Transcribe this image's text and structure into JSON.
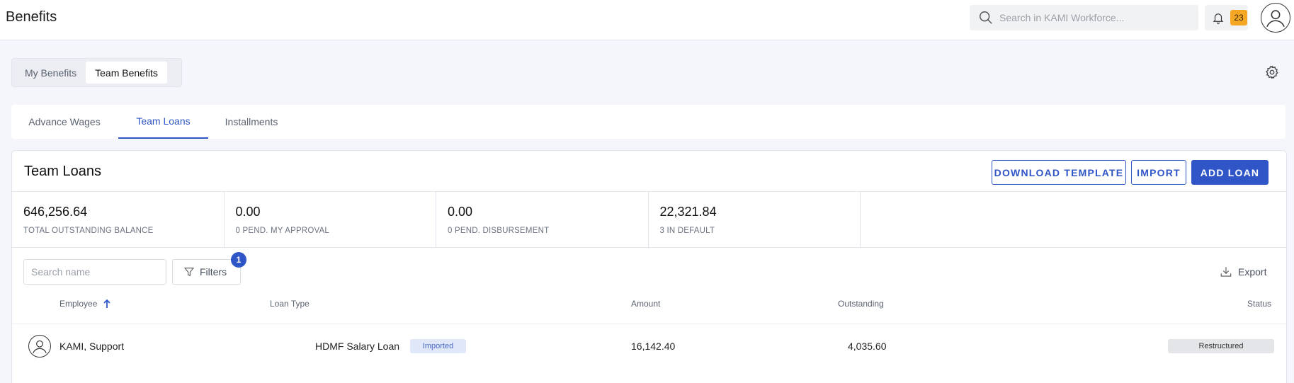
{
  "header": {
    "title": "Benefits",
    "search_placeholder": "Search in KAMI Workforce...",
    "notification_count": "23"
  },
  "segments": [
    {
      "label": "My Benefits",
      "active": false
    },
    {
      "label": "Team Benefits",
      "active": true
    }
  ],
  "tabs": [
    {
      "label": "Advance Wages",
      "active": false
    },
    {
      "label": "Team Loans",
      "active": true
    },
    {
      "label": "Installments",
      "active": false
    }
  ],
  "panel": {
    "title": "Team Loans",
    "buttons": {
      "download_template": "DOWNLOAD TEMPLATE",
      "import": "IMPORT",
      "add_loan": "ADD LOAN"
    }
  },
  "stats": [
    {
      "value": "646,256.64",
      "label": "TOTAL OUTSTANDING BALANCE"
    },
    {
      "value": "0.00",
      "label": "0 PEND. MY APPROVAL"
    },
    {
      "value": "0.00",
      "label": "0 PEND. DISBURSEMENT"
    },
    {
      "value": "22,321.84",
      "label": "3 IN DEFAULT"
    }
  ],
  "toolbar": {
    "search_placeholder": "Search name",
    "filters_label": "Filters",
    "filters_count": "1",
    "export_label": "Export"
  },
  "table": {
    "columns": {
      "employee": "Employee",
      "loan_type": "Loan Type",
      "amount": "Amount",
      "outstanding": "Outstanding",
      "status": "Status"
    },
    "rows": [
      {
        "employee": "KAMI, Support",
        "loan_type": "HDMF Salary Loan",
        "tag": "Imported",
        "amount": "16,142.40",
        "outstanding": "4,035.60",
        "status": "Restructured"
      }
    ]
  },
  "colors": {
    "accent": "#2f55c7",
    "badge": "#f5a623"
  }
}
